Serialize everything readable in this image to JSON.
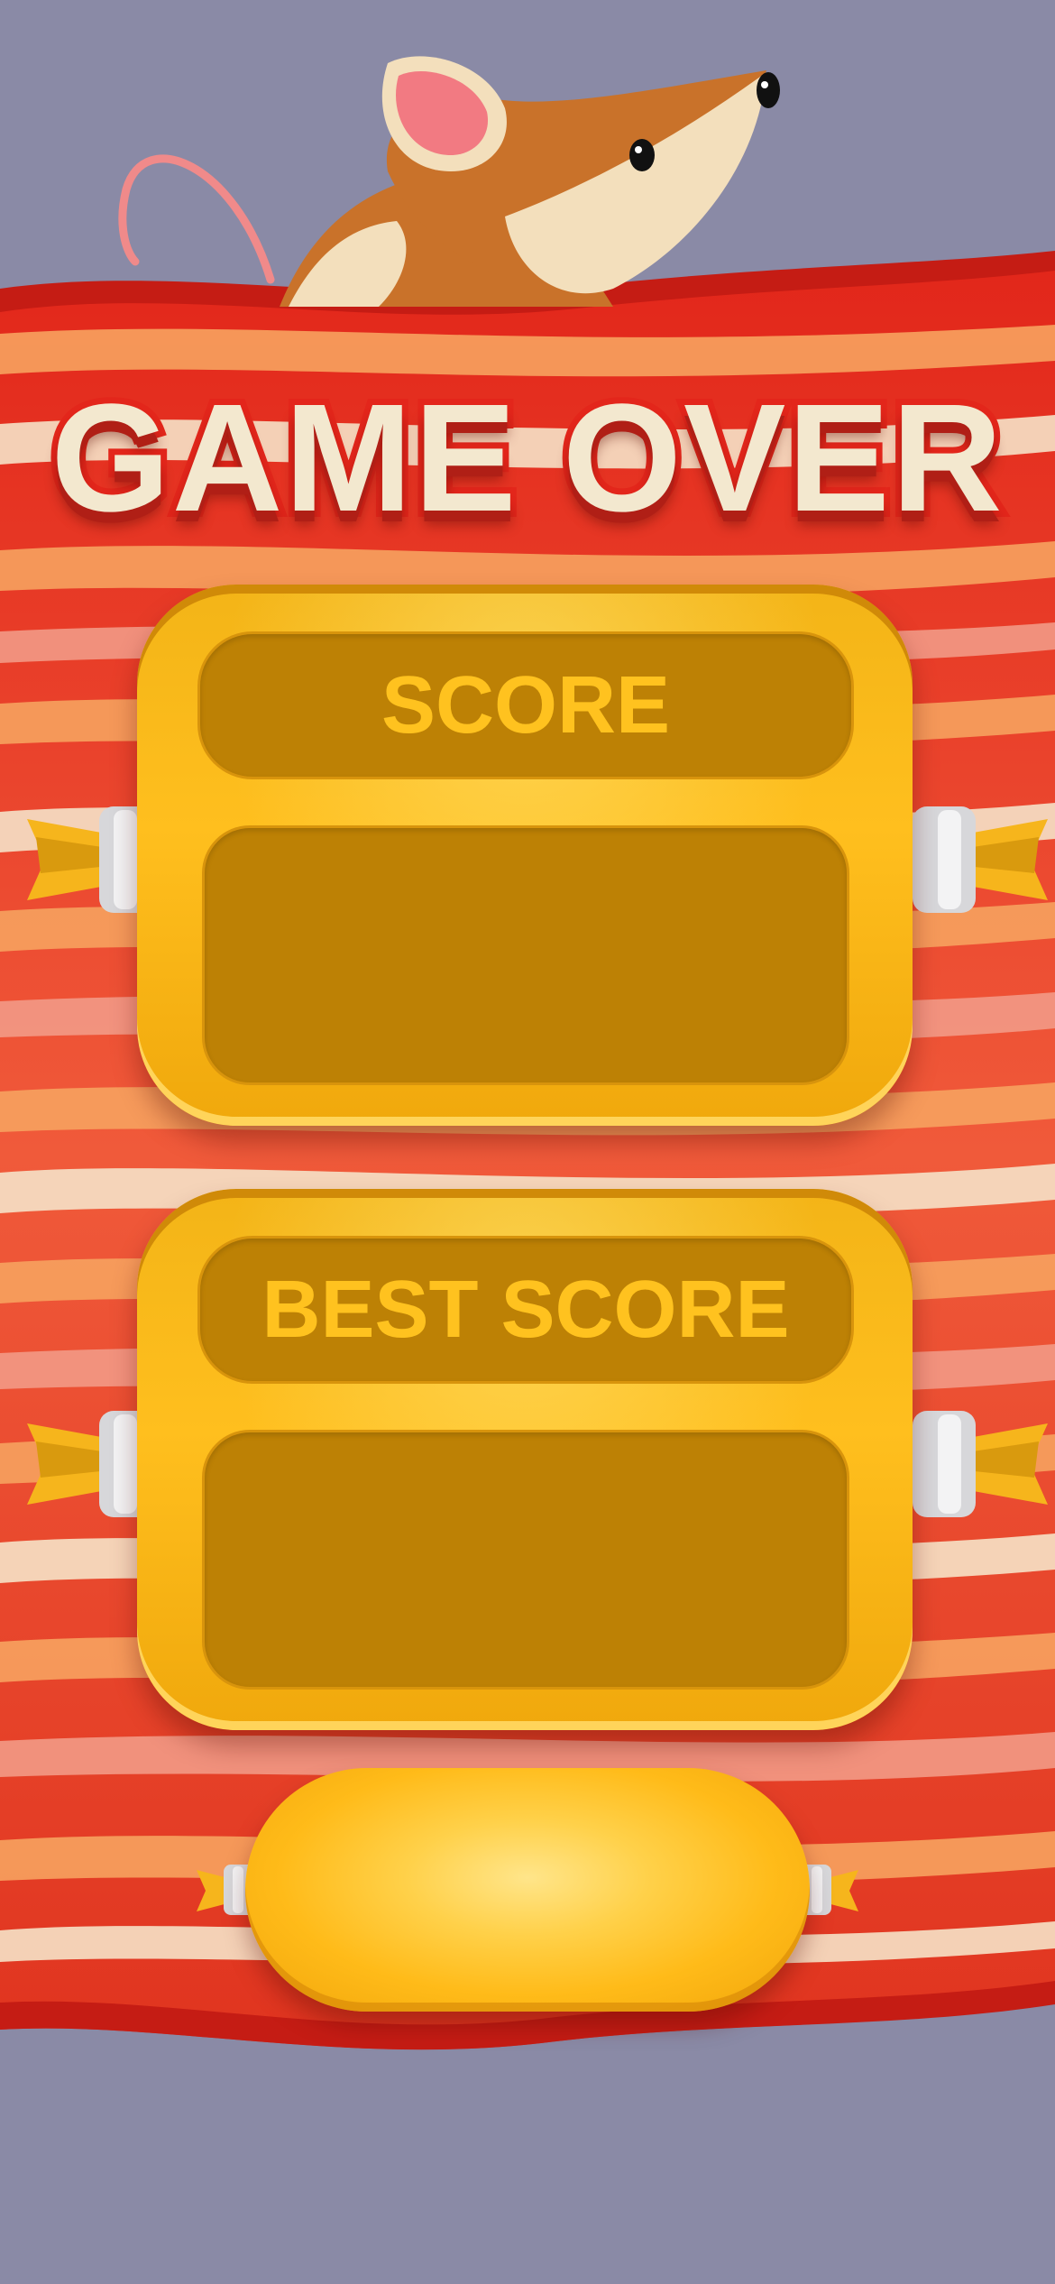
{
  "title": "GAME OVER",
  "score_panel": {
    "label": "SCORE",
    "value": ""
  },
  "best_score_panel": {
    "label": "BEST SCORE",
    "value": ""
  },
  "play_button": {
    "label": ""
  },
  "colors": {
    "background": "#8a8aa6",
    "title_fill": "#f3e8cf",
    "title_stroke": "#e3261b",
    "panel_gold": "#ffbf1e",
    "panel_inner": "#bd8105",
    "label_text": "#ffc21f"
  },
  "icons": [
    "mouse-icon",
    "sausage-wrap-left-icon",
    "sausage-wrap-right-icon"
  ]
}
